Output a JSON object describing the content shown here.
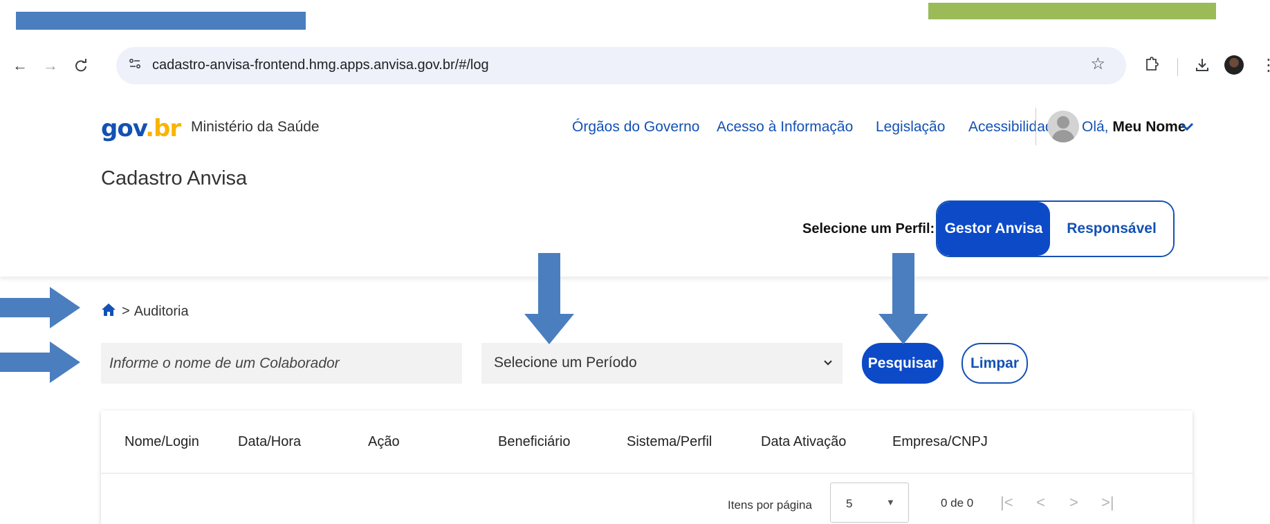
{
  "browser": {
    "url": "cadastro-anvisa-frontend.hmg.apps.anvisa.gov.br/#/log"
  },
  "header": {
    "logo_gov": "gov",
    "logo_br": ".br",
    "ministry": "Ministério da Saúde",
    "links": [
      "Órgãos do Governo",
      "Acesso à Informação",
      "Legislação",
      "Acessibilidade"
    ],
    "greeting": "Olá,",
    "user_name": "Meu Nome",
    "app_title": "Cadastro Anvisa",
    "profile_label": "Selecione um Perfil:",
    "profiles": [
      "Gestor Anvisa",
      "Responsável Legal"
    ],
    "active_profile": "Gestor Anvisa"
  },
  "breadcrumb": {
    "separator": ">",
    "current": "Auditoria"
  },
  "filters": {
    "search_placeholder": "Informe o nome de um Colaborador",
    "period_value": "Selecione um Período",
    "search_button": "Pesquisar",
    "clear_button": "Limpar"
  },
  "table": {
    "columns": [
      "Nome/Login",
      "Data/Hora",
      "Ação",
      "Beneficiário",
      "Sistema/Perfil",
      "Data Ativação",
      "Empresa/CNPJ"
    ],
    "rows": []
  },
  "pagination": {
    "items_label": "Itens por página",
    "items_per_page": "5",
    "range": "0 de 0"
  },
  "colors": {
    "primary": "#1351b4",
    "button_blue": "#0c4ac8",
    "annotation_blue": "#4a7ebf",
    "annotation_green": "#9bbb59"
  }
}
